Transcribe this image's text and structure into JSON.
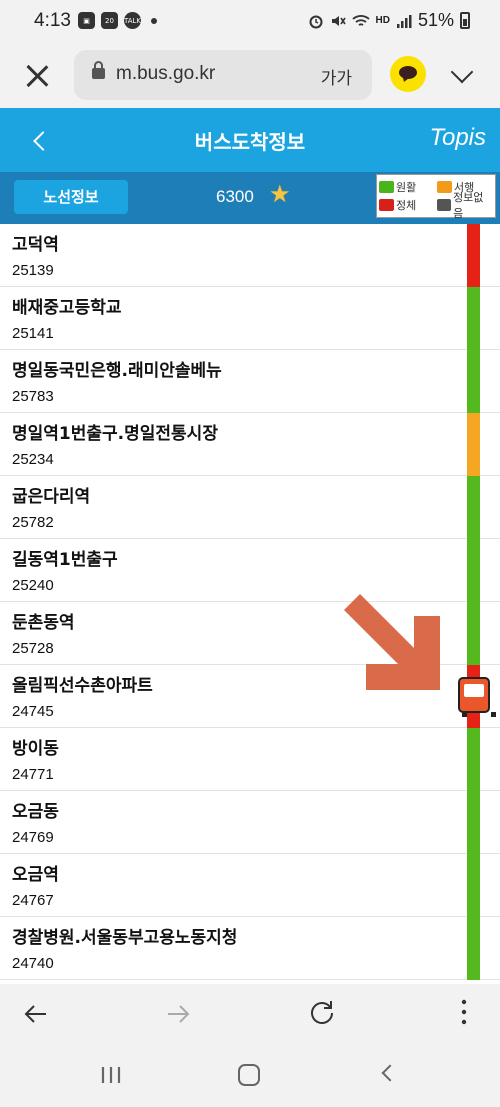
{
  "status_bar": {
    "time": "4:13",
    "notif_icons": [
      "image-icon",
      "blog-icon",
      "talk-icon"
    ],
    "notif_labels": [
      "",
      "20",
      "TALK"
    ],
    "battery": "51%",
    "network_label": "HD"
  },
  "browser": {
    "url": "m.bus.go.kr",
    "font_size_label": "가가"
  },
  "header": {
    "title": "버스도착정보",
    "logo": "Topis"
  },
  "sub_bar": {
    "route_info_label": "노선정보",
    "route_number": "6300"
  },
  "legend": {
    "items": [
      {
        "label": "원활",
        "color": "#49b51a"
      },
      {
        "label": "서행",
        "color": "#f29b1a"
      },
      {
        "label": "정체",
        "color": "#d7201a"
      },
      {
        "label": "정보없음",
        "color": "#555555"
      }
    ]
  },
  "stations": [
    {
      "name": "고덕역",
      "id": "25139",
      "status_color": "#e52216"
    },
    {
      "name": "배재중고등학교",
      "id": "25141",
      "status_color": "#54b81f"
    },
    {
      "name": "명일동국민은행.래미안솔베뉴",
      "id": "25783",
      "status_color": "#54b81f"
    },
    {
      "name": "명일역1번출구.명일전통시장",
      "id": "25234",
      "status_color": "#f5a623"
    },
    {
      "name": "굽은다리역",
      "id": "25782",
      "status_color": "#54b81f"
    },
    {
      "name": "길동역1번출구",
      "id": "25240",
      "status_color": "#54b81f"
    },
    {
      "name": "둔촌동역",
      "id": "25728",
      "status_color": "#54b81f"
    },
    {
      "name": "올림픽선수촌아파트",
      "id": "24745",
      "status_color": "#e52216"
    },
    {
      "name": "방이동",
      "id": "24771",
      "status_color": "#54b81f"
    },
    {
      "name": "오금동",
      "id": "24769",
      "status_color": "#54b81f"
    },
    {
      "name": "오금역",
      "id": "24767",
      "status_color": "#54b81f"
    },
    {
      "name": "경찰병원.서울동부고용노동지청",
      "id": "24740",
      "status_color": "#54b81f"
    }
  ],
  "colors": {
    "header_blue": "#1ba4e0",
    "subbar_blue": "#1e7fb8",
    "bus_marker": "#e9572a",
    "annotation_arrow": "#d96a4a"
  }
}
